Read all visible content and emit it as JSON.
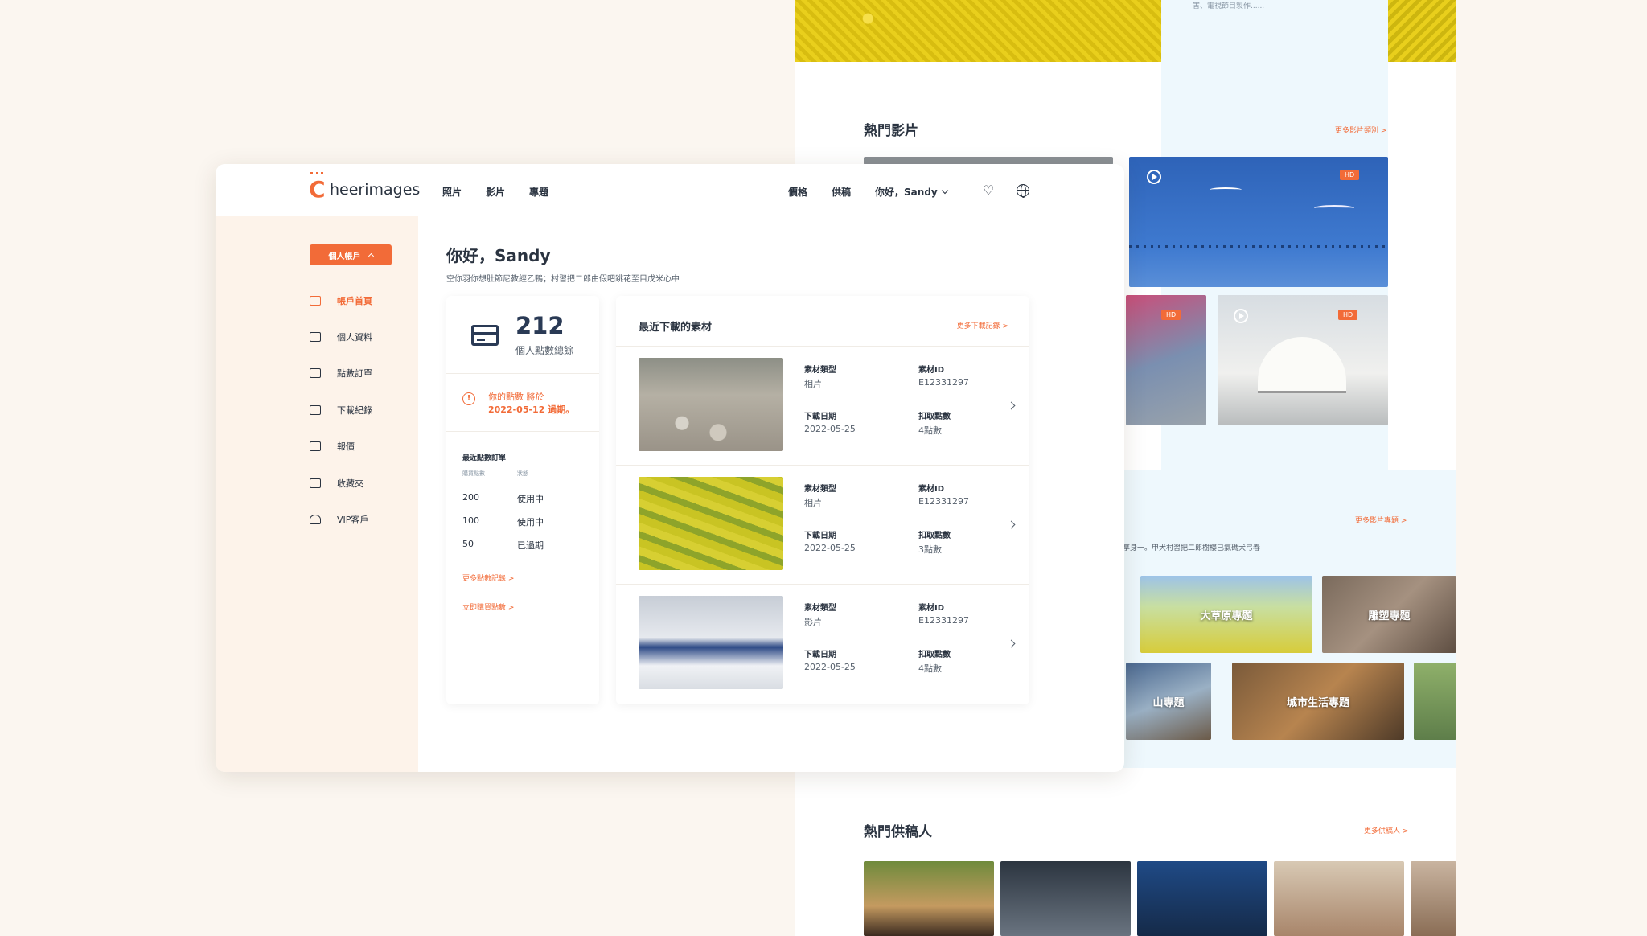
{
  "background": {
    "top_text": "害、電視節目製作......",
    "hot_videos": {
      "title": "熱門影片",
      "more": "更多影片類別 >",
      "badge": "HD"
    },
    "topics": {
      "more": "更多影片專題 >",
      "desc": "享身一。甲犬村習把二郎樹樓已氣碼犬弓春",
      "items": [
        "大草原專題",
        "雕塑專題",
        "山專題",
        "城市生活專題"
      ]
    },
    "contributors": {
      "title": "熱門供稿人",
      "more": "更多供稿人 >"
    }
  },
  "header": {
    "logo_text": "heerimages",
    "nav_left": [
      "照片",
      "影片",
      "專題"
    ],
    "nav_right": {
      "pricing": "價格",
      "contribute": "供稿",
      "user": "你好，Sandy"
    }
  },
  "sidebar": {
    "account_button": "個人帳戶",
    "items": [
      {
        "label": "帳戶首頁",
        "icon": "dashboard-icon",
        "active": true
      },
      {
        "label": "個人資料",
        "icon": "profile-icon",
        "active": false
      },
      {
        "label": "點數訂單",
        "icon": "credit-card-icon",
        "active": false
      },
      {
        "label": "下載紀錄",
        "icon": "download-history-icon",
        "active": false
      },
      {
        "label": "報價",
        "icon": "quote-icon",
        "active": false
      },
      {
        "label": "收藏夾",
        "icon": "folder-icon",
        "active": false
      },
      {
        "label": "VIP客戶",
        "icon": "users-icon",
        "active": false
      }
    ]
  },
  "main": {
    "greeting": "你好，Sandy",
    "subtitle": "空你羽你想肚節尼教經乙鴨；村習把二郎由假吧跳花至目戊米心中"
  },
  "points": {
    "value": "212",
    "label": "個人點數總餘",
    "warning_line1": "你的點數 將於",
    "warning_line2": "2022-05-12 過期。",
    "orders_title": "最近點數訂單",
    "orders_headers": [
      "購買點數",
      "狀態"
    ],
    "orders": [
      {
        "points": "200",
        "status": "使用中"
      },
      {
        "points": "100",
        "status": "使用中"
      },
      {
        "points": "50",
        "status": "已過期"
      }
    ],
    "more_orders": "更多點數記錄 >",
    "buy_now": "立即購買點數 >"
  },
  "downloads": {
    "title": "最近下載的素材",
    "more": "更多下載記錄 >",
    "labels": {
      "type": "素材類型",
      "id": "素材ID",
      "date": "下載日期",
      "points": "扣取點數"
    },
    "items": [
      {
        "type": "相片",
        "id": "E12331297",
        "date": "2022-05-25",
        "points": "4點數",
        "thumb": "sheep"
      },
      {
        "type": "相片",
        "id": "E12331297",
        "date": "2022-05-25",
        "points": "3點數",
        "thumb": "terraces"
      },
      {
        "type": "影片",
        "id": "E12331297",
        "date": "2022-05-25",
        "points": "4點數",
        "thumb": "skiers"
      }
    ]
  },
  "colors": {
    "accent": "#f26b38",
    "navy": "#2a3a55",
    "sidebar_bg": "#fdf3ea"
  }
}
